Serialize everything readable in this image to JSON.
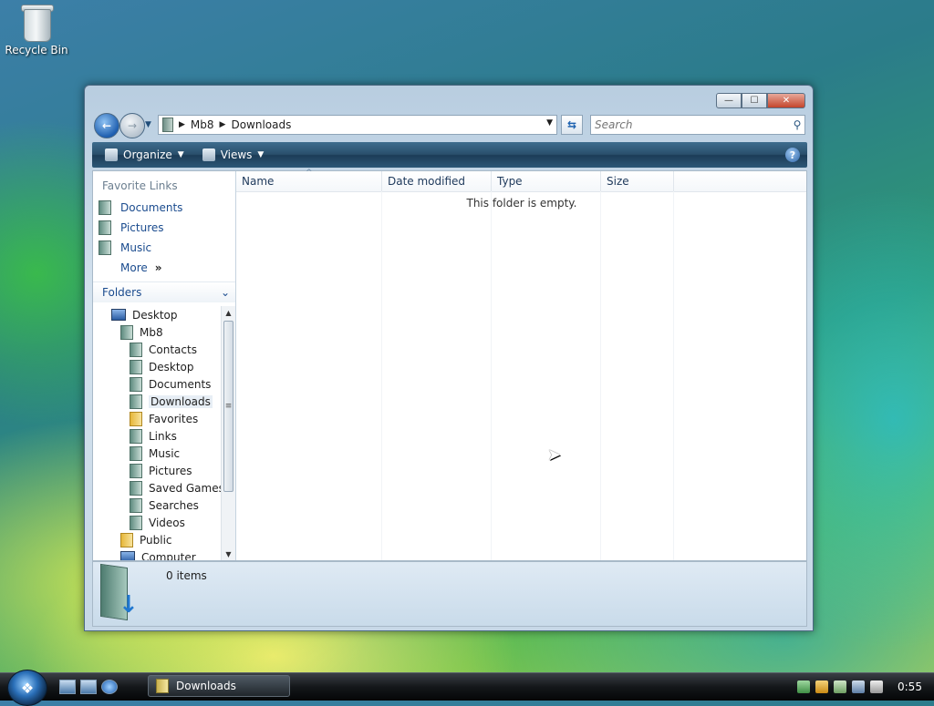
{
  "desktop": {
    "recycle_bin_label": "Recycle Bin"
  },
  "window": {
    "title_buttons": {
      "minimize": "—",
      "maximize": "☐",
      "close": "✕"
    },
    "address": {
      "crumbs": [
        "Mb8",
        "Downloads"
      ]
    },
    "search": {
      "placeholder": "Search"
    },
    "toolbar": {
      "organize": "Organize",
      "views": "Views",
      "help": "?"
    },
    "nav": {
      "favorite_links_header": "Favorite Links",
      "favorites": [
        "Documents",
        "Pictures",
        "Music"
      ],
      "more": "More",
      "folders_header": "Folders",
      "tree": [
        {
          "label": "Desktop",
          "indent": 0,
          "icon": "monitor-icon"
        },
        {
          "label": "Mb8",
          "indent": 1,
          "icon": "user-folder-icon"
        },
        {
          "label": "Contacts",
          "indent": 2,
          "icon": "contacts-icon"
        },
        {
          "label": "Desktop",
          "indent": 2,
          "icon": "folder-icon"
        },
        {
          "label": "Documents",
          "indent": 2,
          "icon": "documents-icon"
        },
        {
          "label": "Downloads",
          "indent": 2,
          "icon": "downloads-icon",
          "selected": true
        },
        {
          "label": "Favorites",
          "indent": 2,
          "icon": "favorites-icon"
        },
        {
          "label": "Links",
          "indent": 2,
          "icon": "links-icon"
        },
        {
          "label": "Music",
          "indent": 2,
          "icon": "music-icon"
        },
        {
          "label": "Pictures",
          "indent": 2,
          "icon": "pictures-icon"
        },
        {
          "label": "Saved Games",
          "indent": 2,
          "icon": "saved-games-icon"
        },
        {
          "label": "Searches",
          "indent": 2,
          "icon": "searches-icon"
        },
        {
          "label": "Videos",
          "indent": 2,
          "icon": "videos-icon"
        },
        {
          "label": "Public",
          "indent": 1,
          "icon": "public-folder-icon"
        },
        {
          "label": "Computer",
          "indent": 1,
          "icon": "computer-icon"
        }
      ]
    },
    "columns": {
      "name": "Name",
      "date": "Date modified",
      "type": "Type",
      "size": "Size"
    },
    "empty_message": "This folder is empty.",
    "details": {
      "items": "0 items"
    }
  },
  "taskbar": {
    "task_label": "Downloads",
    "clock": "0:55"
  },
  "colors": {
    "accent": "#2a4f6c",
    "link": "#1a4b8e"
  }
}
